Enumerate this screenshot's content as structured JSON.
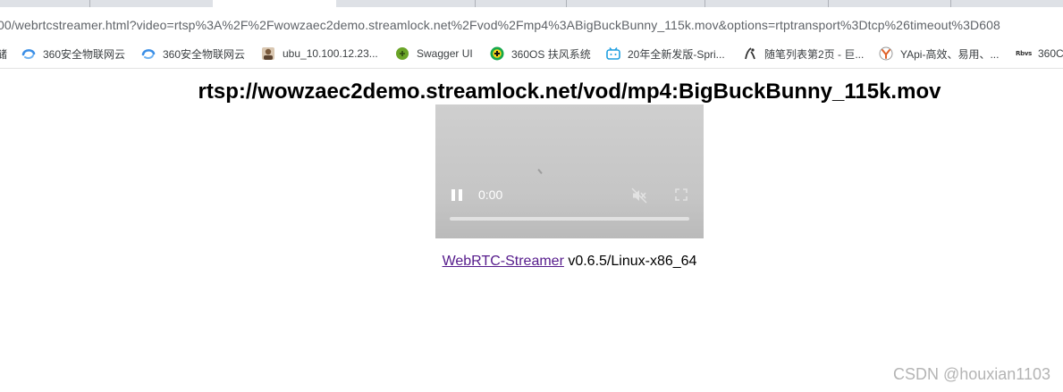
{
  "browser": {
    "url": "00/webrtcstreamer.html?video=rtsp%3A%2F%2Fwowzaec2demo.streamlock.net%2Fvod%2Fmp4%3ABigBuckBunny_115k.mov&options=rtptransport%3Dtcp%26timeout%3D608"
  },
  "bookmarks": [
    {
      "label": "储",
      "icon": "folder-icon"
    },
    {
      "label": "360安全物联网云",
      "icon": "360-icon"
    },
    {
      "label": "360安全物联网云",
      "icon": "360-icon"
    },
    {
      "label": "ubu_10.100.12.23...",
      "icon": "avatar-icon"
    },
    {
      "label": "Swagger UI",
      "icon": "swagger-icon"
    },
    {
      "label": "360OS 扶风系统",
      "icon": "360os-icon"
    },
    {
      "label": "20年全新发版-Spri...",
      "icon": "bilibili-icon"
    },
    {
      "label": "随笔列表第2页 - 巨...",
      "icon": "cnblogs-icon"
    },
    {
      "label": "YApi-高效、易用、...",
      "icon": "yapi-icon"
    },
    {
      "label": "360C",
      "icon": "text-icon",
      "icon_text": "Rbvs"
    }
  ],
  "page": {
    "title": "rtsp://wowzaec2demo.streamlock.net/vod/mp4:BigBuckBunny_115k.mov"
  },
  "video": {
    "time": "0:00",
    "progress": 0
  },
  "footer": {
    "link_text": "WebRTC-Streamer",
    "version": " v0.6.5/Linux-x86_64"
  },
  "watermark": "CSDN @houxian1103",
  "colors": {
    "link": "#551a8b",
    "video_bg": "#c8c8c8"
  }
}
